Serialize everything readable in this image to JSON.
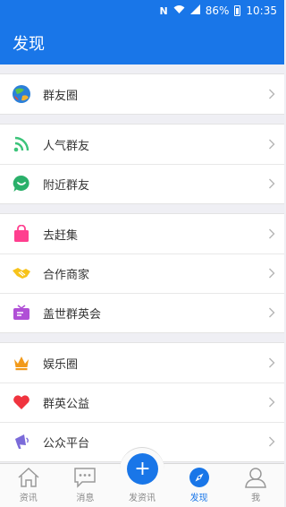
{
  "status_bar": {
    "battery": "86%",
    "time": "10:35",
    "nfc_icon": "N"
  },
  "header": {
    "title": "发现"
  },
  "groups": [
    {
      "items": [
        {
          "label": "群友圈",
          "icon": "globe-icon"
        }
      ]
    },
    {
      "items": [
        {
          "label": "人气群友",
          "icon": "rss-icon"
        },
        {
          "label": "附近群友",
          "icon": "chat-bubble-icon"
        }
      ]
    },
    {
      "items": [
        {
          "label": "去赶集",
          "icon": "shopping-bag-icon"
        },
        {
          "label": "合作商家",
          "icon": "handshake-icon"
        },
        {
          "label": "盖世群英会",
          "icon": "tv-icon"
        }
      ]
    },
    {
      "items": [
        {
          "label": "娱乐圈",
          "icon": "crown-icon"
        },
        {
          "label": "群英公益",
          "icon": "heart-icon"
        },
        {
          "label": "公众平台",
          "icon": "megaphone-icon"
        }
      ]
    }
  ],
  "tabs": [
    {
      "label": "资讯",
      "icon": "home-icon"
    },
    {
      "label": "消息",
      "icon": "message-icon"
    },
    {
      "label": "发资讯",
      "icon": "plus-icon"
    },
    {
      "label": "发现",
      "icon": "compass-icon",
      "active": true
    },
    {
      "label": "我",
      "icon": "user-icon"
    }
  ],
  "fab": {
    "symbol": "+"
  },
  "colors": {
    "primary": "#1976e8",
    "rss": "#3cc47a",
    "chat": "#2ab06a",
    "bag": "#ff3f8f",
    "handshake": "#f7c31a",
    "tv": "#b04fd6",
    "crown": "#f29a1a",
    "heart": "#f0343f",
    "megaphone": "#7b6bd9"
  }
}
